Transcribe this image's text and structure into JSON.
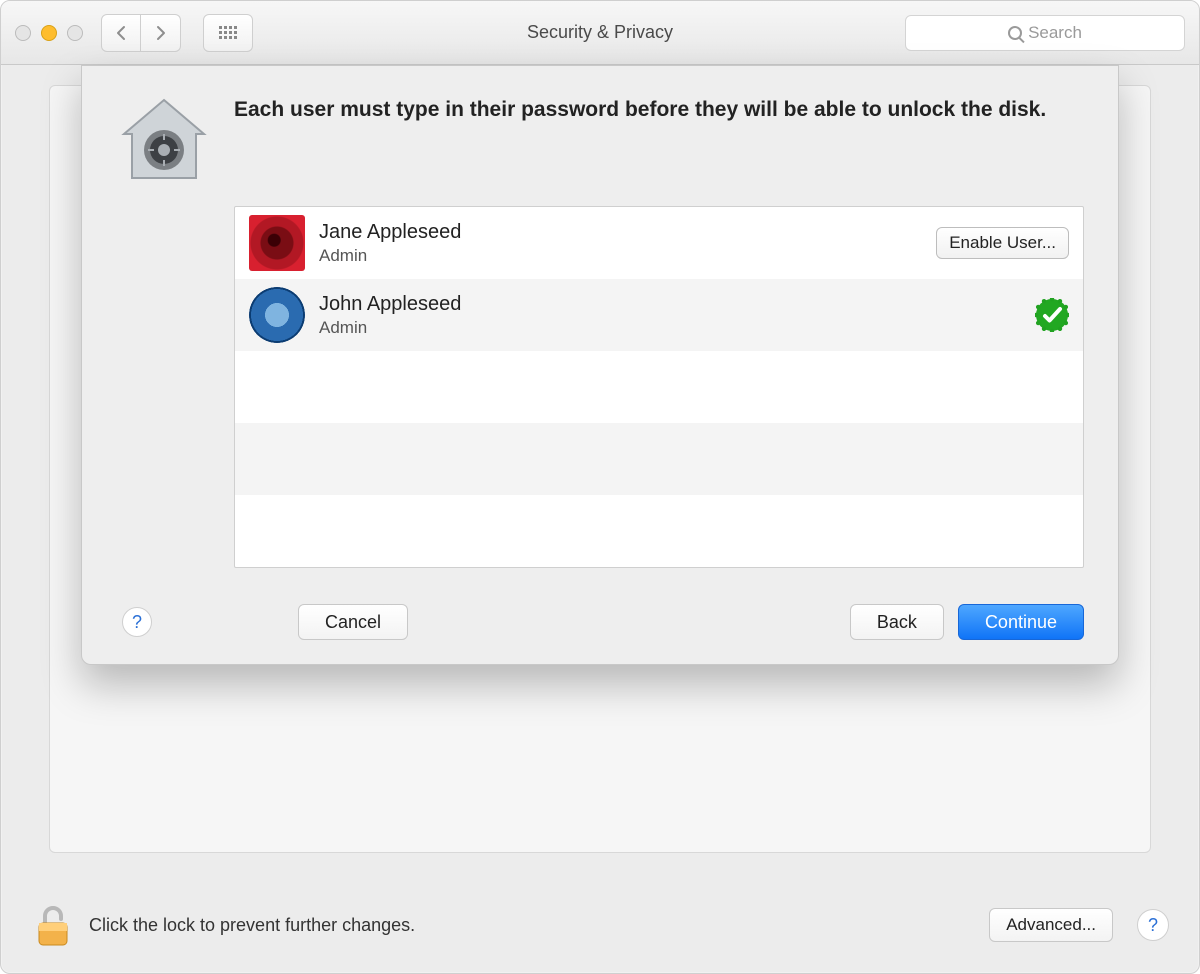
{
  "window": {
    "title": "Security & Privacy",
    "search_placeholder": "Search"
  },
  "lock": {
    "message": "Click the lock to prevent further changes.",
    "advanced_label": "Advanced..."
  },
  "sheet": {
    "headline": "Each user must type in their password before they will be able to unlock the disk.",
    "users": [
      {
        "name": "Jane Appleseed",
        "role": "Admin",
        "avatar": "rose",
        "enabled": false,
        "action_label": "Enable User..."
      },
      {
        "name": "John Appleseed",
        "role": "Admin",
        "avatar": "earth",
        "enabled": true
      }
    ],
    "buttons": {
      "cancel": "Cancel",
      "back": "Back",
      "continue": "Continue"
    }
  }
}
